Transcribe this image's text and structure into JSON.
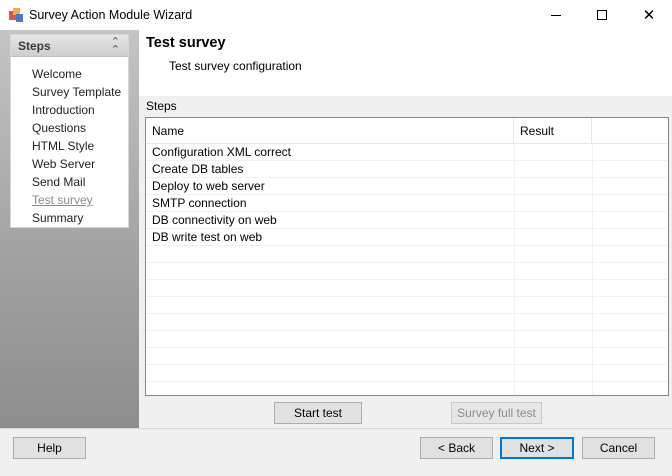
{
  "window": {
    "title": "Survey Action Module Wizard",
    "icon": "app-window-icon"
  },
  "sidebar": {
    "header": "Steps",
    "items": [
      {
        "label": "Welcome"
      },
      {
        "label": "Survey Template"
      },
      {
        "label": "Introduction"
      },
      {
        "label": "Questions"
      },
      {
        "label": "HTML Style"
      },
      {
        "label": "Web Server"
      },
      {
        "label": "Send Mail"
      },
      {
        "label": "Test survey"
      },
      {
        "label": "Summary"
      }
    ],
    "current_index": 7
  },
  "header": {
    "title": "Test survey",
    "subtitle": "Test survey configuration"
  },
  "steps_group": {
    "label": "Steps",
    "columns": [
      "Name",
      "Result"
    ],
    "rows": [
      {
        "name": "Configuration XML correct",
        "result": ""
      },
      {
        "name": "Create DB tables",
        "result": ""
      },
      {
        "name": "Deploy to web server",
        "result": ""
      },
      {
        "name": "SMTP connection",
        "result": ""
      },
      {
        "name": "DB connectivity on web",
        "result": ""
      },
      {
        "name": "DB write test on web",
        "result": ""
      }
    ]
  },
  "actions": {
    "start_test": "Start test",
    "survey_full_test": "Survey full test"
  },
  "footer": {
    "help": "Help",
    "back": "< Back",
    "next": "Next >",
    "cancel": "Cancel"
  }
}
